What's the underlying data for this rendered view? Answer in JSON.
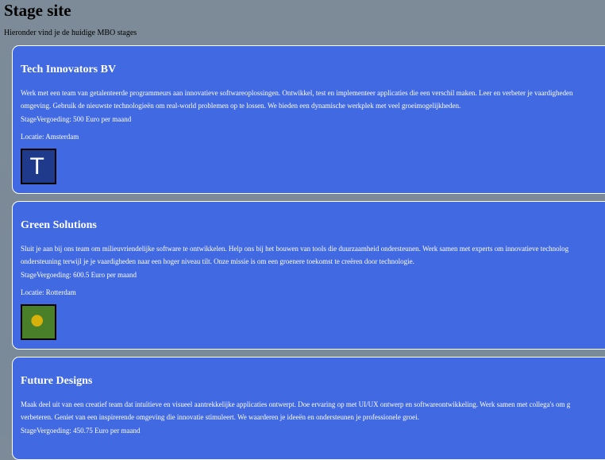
{
  "page": {
    "title": "Stage site",
    "subtitle": "Hieronder vind je de huidige MBO stages"
  },
  "internships": [
    {
      "company": "Tech Innovators BV",
      "description_lines": [
        "Werk met een team van getalenteerde programmeurs aan innovatieve softwareoplossingen. Ontwikkel, test en implementeer applicaties die een verschil maken. Leer en verbeter je vaardigheden",
        "omgeving. Gebruik de nieuwste technologieën om real-world problemen op te lossen. We bieden een dynamische werkplek met veel groeimogelijkheden."
      ],
      "pay": "StageVergoeding: 500 Euro per maand",
      "location": "Locatie: Amsterdam",
      "logo": {
        "icon": "letter-t-logo",
        "letter": "T",
        "background": "#1f3a8a",
        "foreground": "#ffffff"
      }
    },
    {
      "company": "Green Solutions",
      "description_lines": [
        "Sluit je aan bij ons team om milieuvriendelijke software te ontwikkelen. Help ons bij het bouwen van tools die duurzaamheid ondersteunen. Werk samen met experts om innovatieve technolog",
        "ondersteuning terwijl je je vaardigheden naar een hoger niveau tilt. Onze missie is om een groenere toekomst te creëren door technologie."
      ],
      "pay": "StageVergoeding: 600.5 Euro per maand",
      "location": "Locatie: Rotterdam",
      "logo": {
        "icon": "green-circle-logo",
        "background": "#4a7f2a",
        "foreground": "#d9b10b"
      }
    },
    {
      "company": "Future Designs",
      "description_lines": [
        "Maak deel uit van een creatief team dat intuïtieve en visueel aantrekkelijke applicaties ontwerpt. Doe ervaring op met UI/UX ontwerp en softwareontwikkeling. Werk samen met collega's om g",
        "verbeteren. Geniet van een inspirerende omgeving die innovatie stimuleert. We waarderen je ideeën en ondersteunen je professionele groei."
      ],
      "pay": "StageVergoeding: 450.75 Euro per maand"
    }
  ]
}
